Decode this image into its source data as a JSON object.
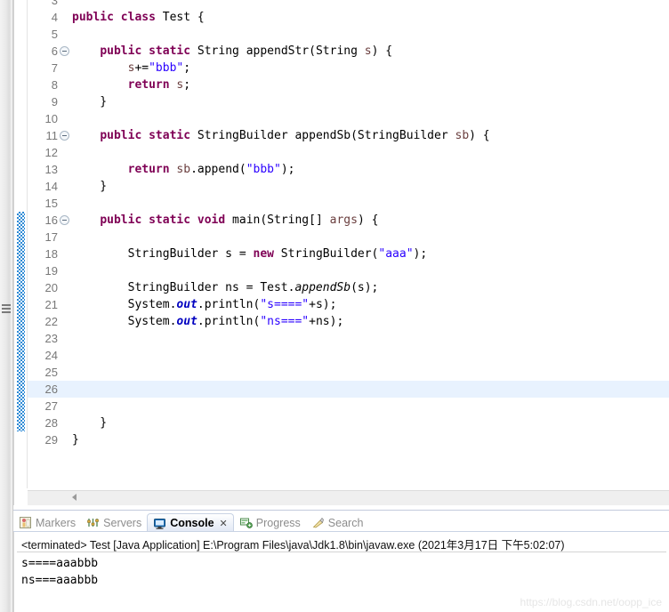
{
  "editor": {
    "first_visible_line": 3,
    "current_line": 26,
    "change_bar_from_line": 16,
    "change_bar_to_line": 28,
    "fold_lines": [
      6,
      11,
      16
    ],
    "lines": [
      {
        "n": 3,
        "tokens": []
      },
      {
        "n": 4,
        "tokens": [
          {
            "t": "public",
            "c": "kw"
          },
          {
            "t": " ",
            "c": ""
          },
          {
            "t": "class",
            "c": "kw"
          },
          {
            "t": " Test {",
            "c": ""
          }
        ]
      },
      {
        "n": 5,
        "tokens": []
      },
      {
        "n": 6,
        "tokens": [
          {
            "t": "    ",
            "c": ""
          },
          {
            "t": "public",
            "c": "kw"
          },
          {
            "t": " ",
            "c": ""
          },
          {
            "t": "static",
            "c": "kw"
          },
          {
            "t": " String appendStr(String ",
            "c": ""
          },
          {
            "t": "s",
            "c": "par"
          },
          {
            "t": ") {",
            "c": ""
          }
        ]
      },
      {
        "n": 7,
        "tokens": [
          {
            "t": "        ",
            "c": ""
          },
          {
            "t": "s",
            "c": "par"
          },
          {
            "t": "+=",
            "c": ""
          },
          {
            "t": "\"bbb\"",
            "c": "str"
          },
          {
            "t": ";",
            "c": ""
          }
        ]
      },
      {
        "n": 8,
        "tokens": [
          {
            "t": "        ",
            "c": ""
          },
          {
            "t": "return",
            "c": "kw"
          },
          {
            "t": " ",
            "c": ""
          },
          {
            "t": "s",
            "c": "par"
          },
          {
            "t": ";",
            "c": ""
          }
        ]
      },
      {
        "n": 9,
        "tokens": [
          {
            "t": "    }",
            "c": ""
          }
        ]
      },
      {
        "n": 10,
        "tokens": []
      },
      {
        "n": 11,
        "tokens": [
          {
            "t": "    ",
            "c": ""
          },
          {
            "t": "public",
            "c": "kw"
          },
          {
            "t": " ",
            "c": ""
          },
          {
            "t": "static",
            "c": "kw"
          },
          {
            "t": " StringBuilder appendSb(StringBuilder ",
            "c": ""
          },
          {
            "t": "sb",
            "c": "par"
          },
          {
            "t": ") {",
            "c": ""
          }
        ]
      },
      {
        "n": 12,
        "tokens": []
      },
      {
        "n": 13,
        "tokens": [
          {
            "t": "        ",
            "c": ""
          },
          {
            "t": "return",
            "c": "kw"
          },
          {
            "t": " ",
            "c": ""
          },
          {
            "t": "sb",
            "c": "par"
          },
          {
            "t": ".append(",
            "c": ""
          },
          {
            "t": "\"bbb\"",
            "c": "str"
          },
          {
            "t": ");",
            "c": ""
          }
        ]
      },
      {
        "n": 14,
        "tokens": [
          {
            "t": "    }",
            "c": ""
          }
        ]
      },
      {
        "n": 15,
        "tokens": []
      },
      {
        "n": 16,
        "tokens": [
          {
            "t": "    ",
            "c": ""
          },
          {
            "t": "public",
            "c": "kw"
          },
          {
            "t": " ",
            "c": ""
          },
          {
            "t": "static",
            "c": "kw"
          },
          {
            "t": " ",
            "c": ""
          },
          {
            "t": "void",
            "c": "kw"
          },
          {
            "t": " main(String[] ",
            "c": ""
          },
          {
            "t": "args",
            "c": "par"
          },
          {
            "t": ") {",
            "c": ""
          }
        ]
      },
      {
        "n": 17,
        "tokens": []
      },
      {
        "n": 18,
        "tokens": [
          {
            "t": "        StringBuilder s = ",
            "c": ""
          },
          {
            "t": "new",
            "c": "kw"
          },
          {
            "t": " StringBuilder(",
            "c": ""
          },
          {
            "t": "\"aaa\"",
            "c": "str"
          },
          {
            "t": ");",
            "c": ""
          }
        ]
      },
      {
        "n": 19,
        "tokens": []
      },
      {
        "n": 20,
        "tokens": [
          {
            "t": "        StringBuilder ns = Test.",
            "c": ""
          },
          {
            "t": "appendSb",
            "c": "mth"
          },
          {
            "t": "(s);",
            "c": ""
          }
        ]
      },
      {
        "n": 21,
        "tokens": [
          {
            "t": "        System.",
            "c": ""
          },
          {
            "t": "out",
            "c": "fld"
          },
          {
            "t": ".println(",
            "c": ""
          },
          {
            "t": "\"s====\"",
            "c": "str"
          },
          {
            "t": "+s);",
            "c": ""
          }
        ]
      },
      {
        "n": 22,
        "tokens": [
          {
            "t": "        System.",
            "c": ""
          },
          {
            "t": "out",
            "c": "fld"
          },
          {
            "t": ".println(",
            "c": ""
          },
          {
            "t": "\"ns===\"",
            "c": "str"
          },
          {
            "t": "+ns);",
            "c": ""
          }
        ]
      },
      {
        "n": 23,
        "tokens": []
      },
      {
        "n": 24,
        "tokens": []
      },
      {
        "n": 25,
        "tokens": []
      },
      {
        "n": 26,
        "tokens": []
      },
      {
        "n": 27,
        "tokens": []
      },
      {
        "n": 28,
        "tokens": [
          {
            "t": "    }",
            "c": ""
          }
        ]
      },
      {
        "n": 29,
        "tokens": [
          {
            "t": "}",
            "c": ""
          }
        ]
      }
    ]
  },
  "colors": {
    "keyword": "#7F0055",
    "string": "#2A00FF",
    "static_field": "#0000C0",
    "parameter": "#6A3E3E",
    "current_line_highlight": "#E8F2FE",
    "change_bar": "#2E8BD6",
    "active_tab_border": "#C9D3E4"
  },
  "bottom_panel": {
    "tabs": [
      {
        "label": "Markers",
        "icon": "markers-icon",
        "active": false,
        "closable": false
      },
      {
        "label": "Servers",
        "icon": "servers-icon",
        "active": false,
        "closable": false
      },
      {
        "label": "Console",
        "icon": "console-icon",
        "active": true,
        "closable": true
      },
      {
        "label": "Progress",
        "icon": "progress-icon",
        "active": false,
        "closable": false
      },
      {
        "label": "Search",
        "icon": "search-icon",
        "active": false,
        "closable": false
      }
    ],
    "close_glyph": "✕",
    "console": {
      "header": "<terminated> Test [Java Application] E:\\Program Files\\java\\Jdk1.8\\bin\\javaw.exe (2021年3月17日 下午5:02:07)",
      "output": "s====aaabbb\nns===aaabbb"
    }
  },
  "watermark": {
    "text": "https://blog.csdn.net/oopp_ice"
  },
  "scrollbar": {
    "left_arrow_glyph": "◀"
  }
}
